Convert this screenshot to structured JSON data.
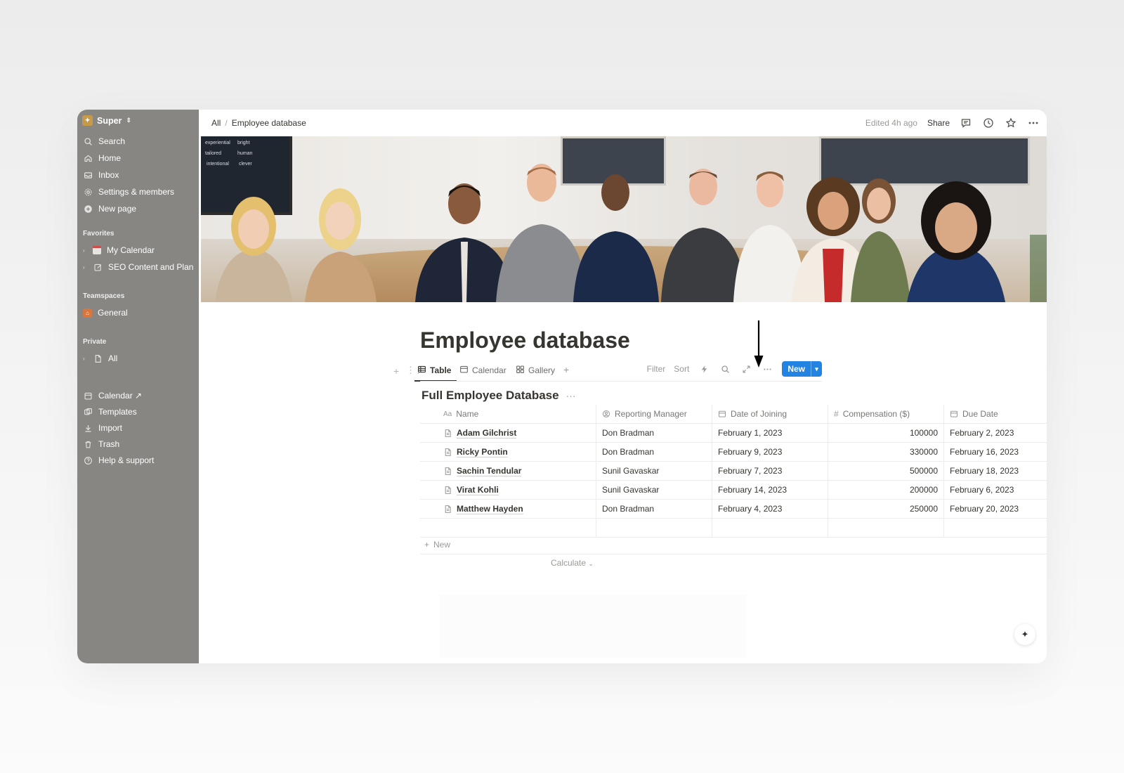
{
  "sidebar": {
    "workspace": "Super",
    "items": [
      {
        "label": "Search",
        "icon": "search-icon"
      },
      {
        "label": "Home",
        "icon": "home-icon"
      },
      {
        "label": "Inbox",
        "icon": "inbox-icon"
      },
      {
        "label": "Settings & members",
        "icon": "gear-icon"
      },
      {
        "label": "New page",
        "icon": "plus-circle-icon"
      }
    ],
    "favorites_heading": "Favorites",
    "favorites": [
      {
        "label": "My Calendar",
        "icon": "calendar-page-icon"
      },
      {
        "label": "SEO Content and Plan",
        "icon": "edit-page-icon"
      }
    ],
    "teamspaces_heading": "Teamspaces",
    "teamspaces": [
      {
        "label": "General",
        "icon": "home-teamspace-icon"
      }
    ],
    "private_heading": "Private",
    "private": [
      {
        "label": "All",
        "icon": "page-icon"
      }
    ],
    "bottom": [
      {
        "label": "Calendar ↗",
        "icon": "calendar-icon"
      },
      {
        "label": "Templates",
        "icon": "templates-icon"
      },
      {
        "label": "Import",
        "icon": "import-icon"
      },
      {
        "label": "Trash",
        "icon": "trash-icon"
      },
      {
        "label": "Help & support",
        "icon": "help-icon"
      }
    ]
  },
  "topbar": {
    "breadcrumb": [
      "All",
      "Employee database"
    ],
    "edited": "Edited 4h ago",
    "share": "Share"
  },
  "cover": {
    "screen_words": [
      "experiential",
      "bright",
      "tailored",
      "human",
      "intentional",
      "clever"
    ]
  },
  "page": {
    "title": "Employee database",
    "views": [
      {
        "label": "Table",
        "icon": "table-icon",
        "active": true
      },
      {
        "label": "Calendar",
        "icon": "calendar-icon",
        "active": false
      },
      {
        "label": "Gallery",
        "icon": "gallery-icon",
        "active": false
      }
    ],
    "tools": {
      "filter": "Filter",
      "sort": "Sort",
      "new": "New"
    },
    "db_title": "Full Employee Database",
    "columns": [
      {
        "label": "Name",
        "icon": "text-property-icon"
      },
      {
        "label": "Reporting Manager",
        "icon": "person-property-icon"
      },
      {
        "label": "Date of Joining",
        "icon": "date-property-icon"
      },
      {
        "label": "Compensation ($)",
        "icon": "number-property-icon"
      },
      {
        "label": "Due Date",
        "icon": "date-property-icon"
      }
    ],
    "rows": [
      {
        "name": "Adam Gilchrist",
        "manager": "Don Bradman",
        "joining": "February 1, 2023",
        "compensation": "100000",
        "due": "February 2, 2023"
      },
      {
        "name": "Ricky Pontin",
        "manager": "Don Bradman",
        "joining": "February 9, 2023",
        "compensation": "330000",
        "due": "February 16, 2023"
      },
      {
        "name": "Sachin Tendular",
        "manager": "Sunil Gavaskar",
        "joining": "February 7, 2023",
        "compensation": "500000",
        "due": "February 18, 2023"
      },
      {
        "name": "Virat Kohli",
        "manager": "Sunil Gavaskar",
        "joining": "February 14, 2023",
        "compensation": "200000",
        "due": "February 6, 2023"
      },
      {
        "name": "Matthew Hayden",
        "manager": "Don Bradman",
        "joining": "February 4, 2023",
        "compensation": "250000",
        "due": "February 20, 2023"
      }
    ],
    "add_new": "New",
    "calculate": "Calculate"
  },
  "colors": {
    "accent": "#2383e2",
    "sidebar_bg": "#878683",
    "text": "#37352f"
  }
}
